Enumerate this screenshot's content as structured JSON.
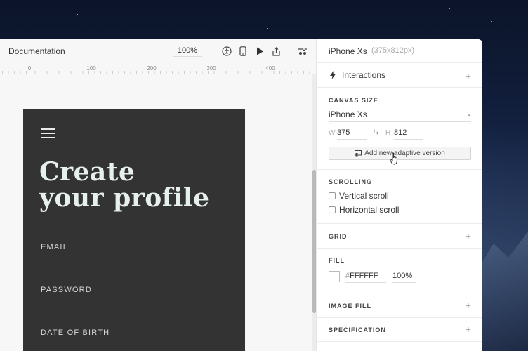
{
  "toolbar": {
    "document_title": "Documentation",
    "zoom": "100%",
    "icons": [
      "accessibility-icon",
      "mobile-device-icon",
      "play-icon",
      "share-icon",
      "settings-toggle-icon"
    ]
  },
  "ruler": {
    "labels": [
      "0",
      "100",
      "200",
      "300",
      "400"
    ]
  },
  "artboard": {
    "headline_line1": "Create",
    "headline_line2": "your profile",
    "fields": [
      "EMAIL",
      "PASSWORD",
      "DATE OF BIRTH"
    ],
    "background_color": "#333333"
  },
  "panel": {
    "device_name": "iPhone Xs",
    "device_dims": "(375x812px)",
    "interactions_label": "Interactions",
    "canvas_size": {
      "title": "CANVAS SIZE",
      "preset": "iPhone Xs",
      "w_label": "W",
      "w_value": "375",
      "h_label": "H",
      "h_value": "812",
      "adaptive_button": "Add new adaptive version"
    },
    "scrolling": {
      "title": "SCROLLING",
      "vertical": "Vertical scroll",
      "horizontal": "Horizontal scroll"
    },
    "grid_title": "GRID",
    "fill": {
      "title": "FILL",
      "hash": "#",
      "hex": "FFFFFF",
      "opacity": "100%"
    },
    "image_fill_title": "IMAGE FILL",
    "specification_title": "SPECIFICATION"
  }
}
